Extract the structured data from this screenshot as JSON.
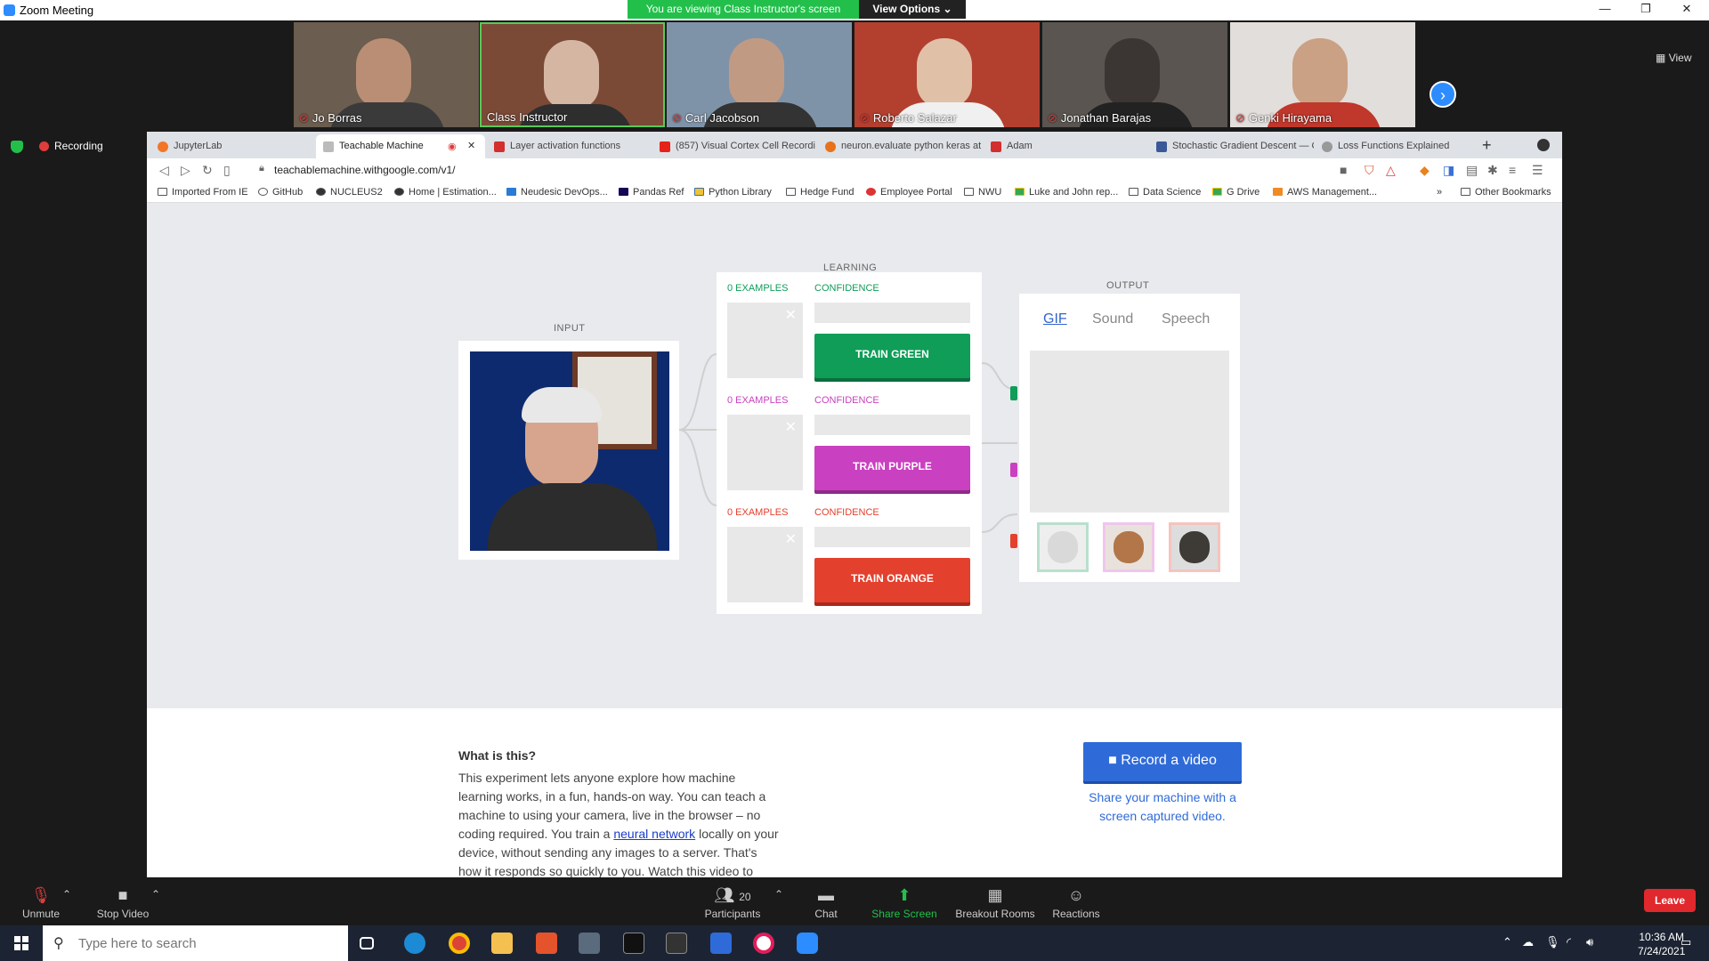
{
  "window": {
    "title": "Zoom Meeting",
    "viewing_banner": "You are viewing Class Instructor's screen",
    "view_options": "View Options",
    "view_label": "View"
  },
  "participants_gallery": [
    {
      "name": "Jo Borras",
      "muted": true
    },
    {
      "name": "Class Instructor",
      "muted": false
    },
    {
      "name": "Carl Jacobson",
      "muted": true
    },
    {
      "name": "Roberto Salazar",
      "muted": true
    },
    {
      "name": "Jonathan Barajas",
      "muted": true
    },
    {
      "name": "Genki Hirayama",
      "muted": true
    }
  ],
  "recording_label": "Recording",
  "browser": {
    "tabs": [
      {
        "label": "JupyterLab",
        "color": "#f37626"
      },
      {
        "label": "Teachable Machine",
        "color": "#888888",
        "active": true
      },
      {
        "label": "Layer activation functions",
        "color": "#d32f2f"
      },
      {
        "label": "(857) Visual Cortex Cell Recordi",
        "color": "#e62117"
      },
      {
        "label": "neuron.evaluate python keras at",
        "color": "#e8711a"
      },
      {
        "label": "Adam",
        "color": "#d32f2f"
      },
      {
        "label": "Stochastic Gradient Descent — C",
        "color": "#3b5998"
      },
      {
        "label": "Loss Functions Explained",
        "color": "#888888"
      }
    ],
    "url": "teachablemachine.withgoogle.com/v1/",
    "bookmarks": [
      "Imported From IE",
      "GitHub",
      "NUCLEUS2",
      "Home | Estimation...",
      "Neudesic DevOps...",
      "Pandas Ref",
      "Python Library",
      "Hedge Fund",
      "Employee Portal",
      "NWU",
      "Luke and John rep...",
      "Data Science",
      "G Drive",
      "AWS Management..."
    ],
    "bookmarks_more": "»",
    "other_bookmarks": "Other Bookmarks"
  },
  "teachable": {
    "learning_label": "LEARNING",
    "input_label": "INPUT",
    "output_label": "OUTPUT",
    "classes": [
      {
        "examples": "0 EXAMPLES",
        "confidence": "CONFIDENCE",
        "button": "TRAIN GREEN",
        "color": "#0f9d58",
        "shadow": "#0a6e3e"
      },
      {
        "examples": "0 EXAMPLES",
        "confidence": "CONFIDENCE",
        "button": "TRAIN PURPLE",
        "color": "#c940c0",
        "shadow": "#8f2a88"
      },
      {
        "examples": "0 EXAMPLES",
        "confidence": "CONFIDENCE",
        "button": "TRAIN ORANGE",
        "color": "#e3402e",
        "shadow": "#a82a1c"
      }
    ],
    "output_tabs": [
      "GIF",
      "Sound",
      "Speech"
    ],
    "what_title": "What is this?",
    "what_body_1": "This experiment lets anyone explore how machine learning works, in a fun, hands-on way. You can teach a machine to using your camera, live in the browser – no coding required. You train a ",
    "what_link_1": "neural network",
    "what_body_2": " locally on your device, without sending any images to a server. That's how it responds so quickly to you. Watch this video to learn more:",
    "record_button": "■ Record a video",
    "share_text": "Share your machine with a screen captured video."
  },
  "zoom_controls": {
    "unmute": "Unmute",
    "stop_video": "Stop Video",
    "participants": "Participants",
    "participant_count": "20",
    "chat": "Chat",
    "share_screen": "Share Screen",
    "breakout_rooms": "Breakout Rooms",
    "reactions": "Reactions",
    "leave": "Leave"
  },
  "taskbar": {
    "search_placeholder": "Type here to search",
    "time": "10:36 AM",
    "date": "7/24/2021"
  }
}
